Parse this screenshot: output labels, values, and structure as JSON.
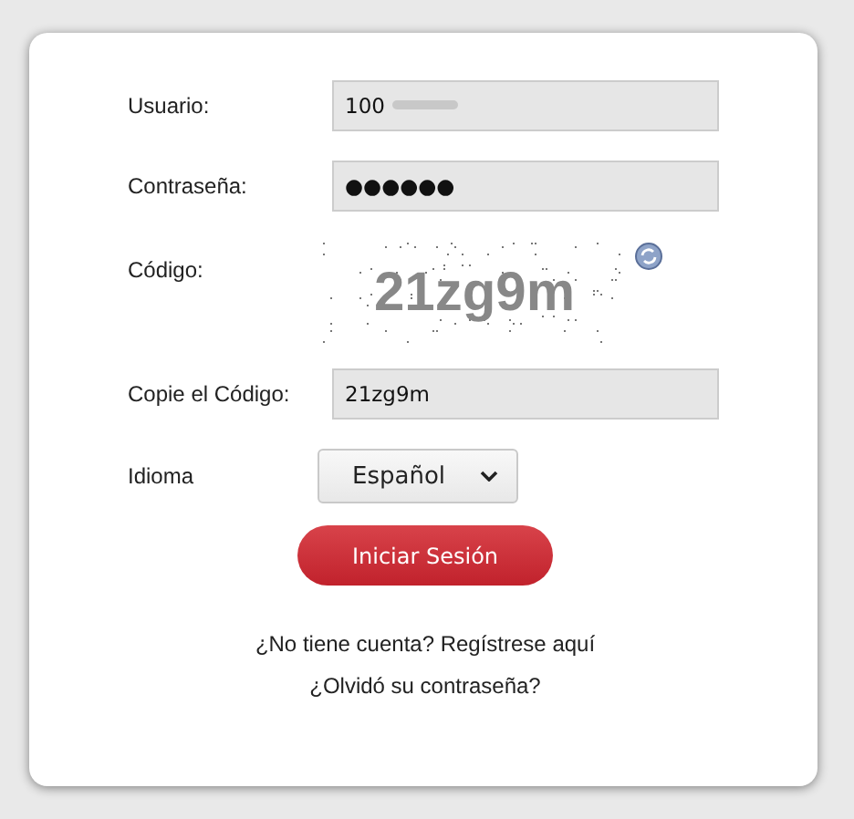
{
  "form": {
    "fields": [
      {
        "kind": "text",
        "label": "Usuario:",
        "value": "100",
        "blurred": true
      },
      {
        "kind": "text",
        "label": "Contraseña:",
        "value": "●●●●●●",
        "blurred": false
      },
      {
        "kind": "captcha",
        "label": "Código:",
        "value": "21zg9m"
      },
      {
        "kind": "text",
        "label": "Copie el Código:",
        "value": "21zg9m",
        "blurred": false
      },
      {
        "kind": "select",
        "label": "Idioma",
        "value": "Español"
      }
    ],
    "submit": "Iniciar Sesión",
    "links": [
      "¿No tiene cuenta? Regístrese aquí",
      "¿Olvidó su contraseña?"
    ]
  }
}
